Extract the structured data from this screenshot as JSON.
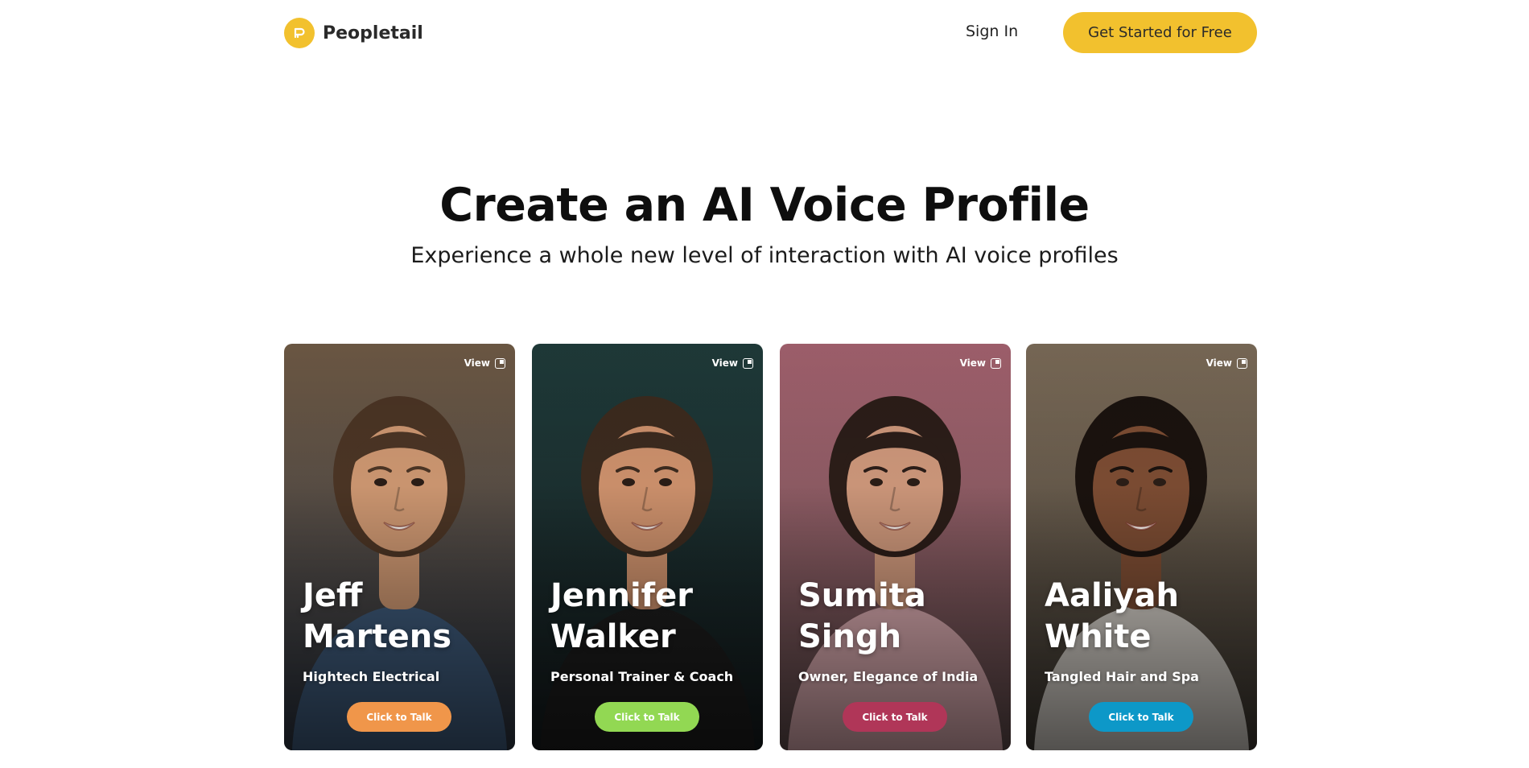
{
  "header": {
    "brand": "Peopletail",
    "sign_in": "Sign In",
    "cta": "Get Started for Free",
    "logo_icon": "peopletail-logo-icon"
  },
  "hero": {
    "title": "Create an AI Voice Profile",
    "subtitle": "Experience a whole new level of interaction with AI voice profiles"
  },
  "profiles": [
    {
      "first": "Jeff",
      "last": "Martens",
      "role": "Hightech Electrical",
      "view": "View",
      "button": "Click to Talk",
      "button_color": "#f0964a",
      "bg_top": "#6f5a45",
      "bg_bottom": "#2a3340",
      "skin": "#c9946f",
      "hair": "#4a3424",
      "shirt": "#3e5a7a"
    },
    {
      "first": "Jennifer",
      "last": "Walker",
      "role": "Personal Trainer & Coach",
      "view": "View",
      "button": "Click to Talk",
      "button_color": "#92d853",
      "bg_top": "#1f3b3a",
      "bg_bottom": "#141a1c",
      "skin": "#c98e6a",
      "hair": "#3b2a1e",
      "shirt": "#1c1c1c"
    },
    {
      "first": "Sumita",
      "last": "Singh",
      "role": "Owner, Elegance of India",
      "view": "View",
      "button": "Click to Talk",
      "button_color": "#b03658",
      "bg_top": "#a4626f",
      "bg_bottom": "#5d4a4a",
      "skin": "#c99478",
      "hair": "#2b1d18",
      "shirt": "#d7a8ad"
    },
    {
      "first": "Aaliyah",
      "last": "White",
      "role": "Tangled Hair and Spa",
      "view": "View",
      "button": "Click to Talk",
      "button_color": "#0d98c8",
      "bg_top": "#7b6b58",
      "bg_bottom": "#3b3630",
      "skin": "#7a4b32",
      "hair": "#1a120e",
      "shirt": "#cfcac3"
    }
  ]
}
